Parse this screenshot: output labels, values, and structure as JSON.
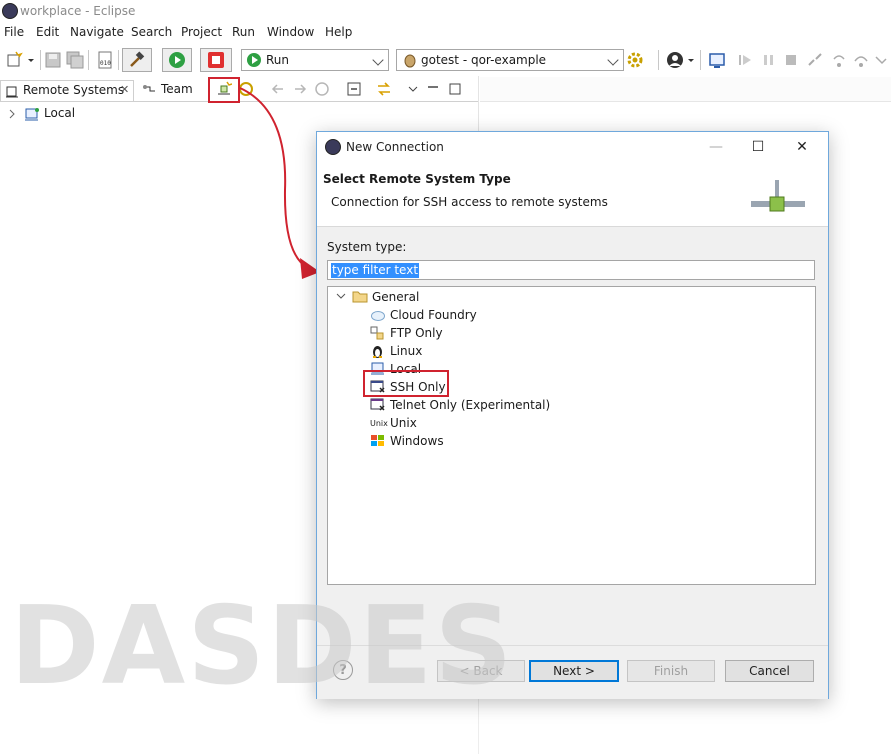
{
  "window": {
    "title": "workplace - Eclipse"
  },
  "menu": [
    "File",
    "Edit",
    "Navigate",
    "Search",
    "Project",
    "Run",
    "Window",
    "Help"
  ],
  "toolbar": {
    "run_combo": "Run",
    "launch_combo": "gotest - qor-example"
  },
  "views": {
    "remote_tab": "Remote Systems",
    "remote_tab_close": "✕",
    "team_tab": "Team"
  },
  "tree": {
    "local": "Local"
  },
  "dialog": {
    "title": "New Connection",
    "header_title": "Select Remote System Type",
    "header_desc": "Connection for SSH access to remote systems",
    "system_type_label": "System type:",
    "filter_value": "type filter text",
    "group": "General",
    "items": [
      "Cloud Foundry",
      "FTP Only",
      "Linux",
      "Local",
      "SSH Only",
      "Telnet Only (Experimental)",
      "Unix",
      "Windows"
    ],
    "buttons": {
      "back": "< Back",
      "next": "Next >",
      "finish": "Finish",
      "cancel": "Cancel"
    },
    "help": "?",
    "unix_icon_text": "Unix"
  },
  "watermark": "DASDES",
  "colors": {
    "highlight_red": "#d0232f",
    "selection_blue": "#3390ff",
    "default_button_border": "#0078d7"
  }
}
